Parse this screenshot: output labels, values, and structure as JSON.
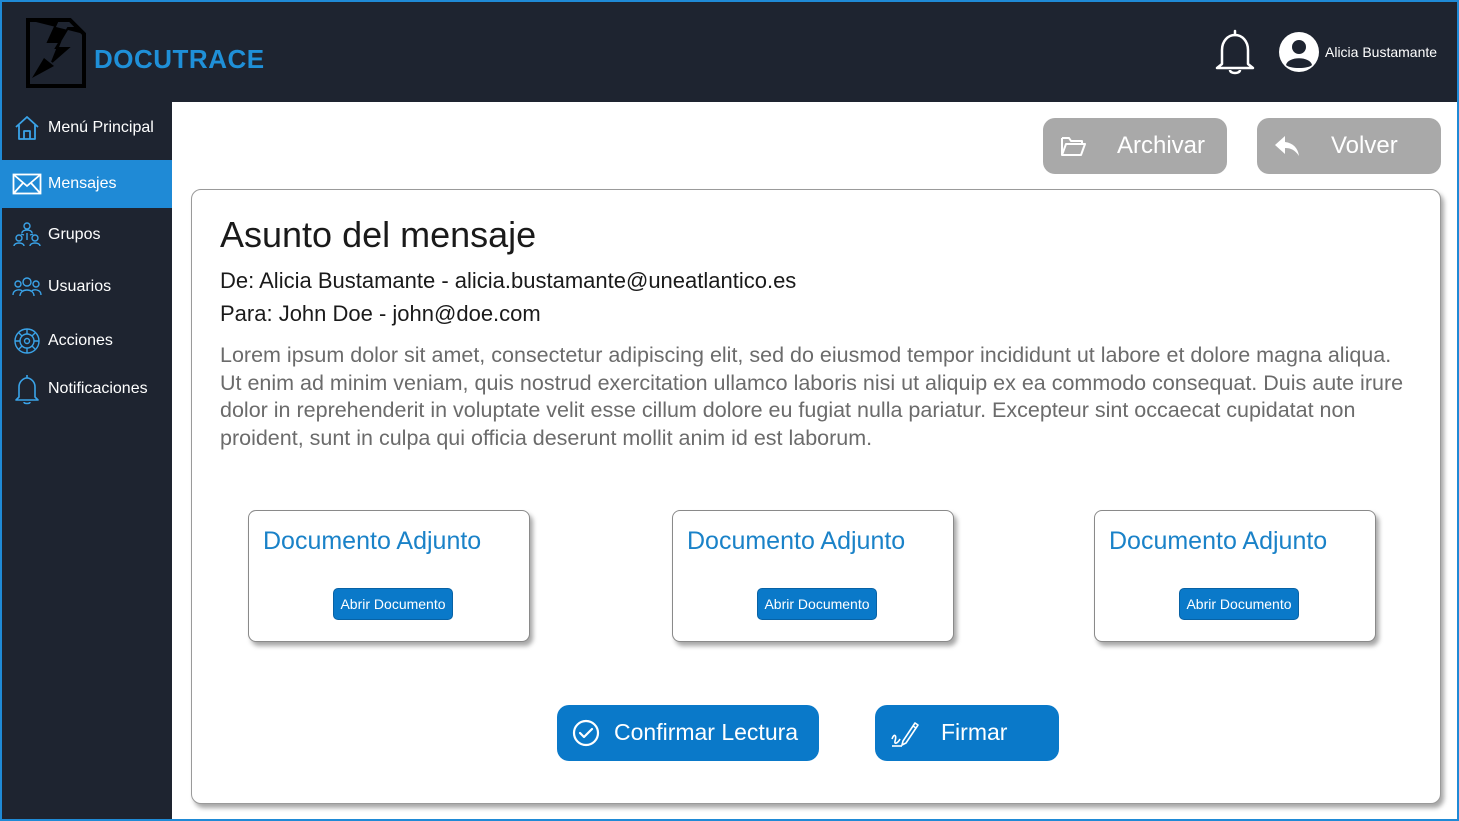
{
  "app": {
    "brand": "DOCUTRACE",
    "user_name": "Alicia Bustamante",
    "accent_color": "#1f8ad6",
    "header_color": "#1e2430"
  },
  "sidebar": {
    "items": [
      {
        "label": "Menú Principal",
        "icon": "home-icon",
        "active": false
      },
      {
        "label": "Mensajes",
        "icon": "envelope-icon",
        "active": true
      },
      {
        "label": "Grupos",
        "icon": "groups-icon",
        "active": false
      },
      {
        "label": "Usuarios",
        "icon": "users-icon",
        "active": false
      },
      {
        "label": "Acciones",
        "icon": "actions-icon",
        "active": false
      },
      {
        "label": "Notificaciones",
        "icon": "bell-icon",
        "active": false
      }
    ]
  },
  "toolbar": {
    "archive_label": "Archivar",
    "back_label": "Volver"
  },
  "message": {
    "subject": "Asunto del mensaje",
    "from": "De: Alicia Bustamante - alicia.bustamante@uneatlantico.es",
    "to": "Para: John Doe - john@doe.com",
    "body": "Lorem ipsum dolor sit amet, consectetur adipiscing elit, sed do eiusmod tempor incididunt ut labore et dolore magna aliqua. Ut enim ad minim veniam, quis nostrud exercitation ullamco laboris nisi ut aliquip ex ea commodo consequat. Duis aute irure dolor in reprehenderit in voluptate velit esse cillum dolore eu fugiat nulla pariatur. Excepteur sint occaecat cupidatat non proident, sunt in culpa qui officia deserunt mollit anim id est laborum."
  },
  "attachments": [
    {
      "title": "Documento Adjunto",
      "button": "Abrir Documento"
    },
    {
      "title": "Documento Adjunto",
      "button": "Abrir Documento"
    },
    {
      "title": "Documento Adjunto",
      "button": "Abrir Documento"
    }
  ],
  "actions": {
    "confirm_label": "Confirmar Lectura",
    "sign_label": "Firmar"
  }
}
